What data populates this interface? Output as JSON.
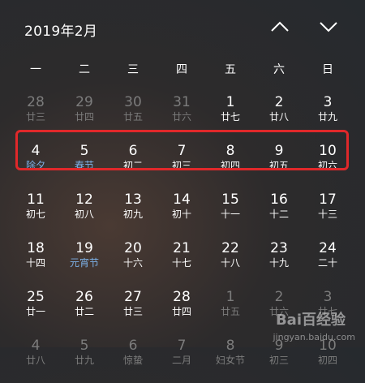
{
  "header": {
    "title": "2019年2月"
  },
  "weekdays": [
    "一",
    "二",
    "三",
    "四",
    "五",
    "六",
    "日"
  ],
  "weeks": [
    [
      {
        "d": "28",
        "l": "廿三",
        "muted": true
      },
      {
        "d": "29",
        "l": "廿四",
        "muted": true
      },
      {
        "d": "30",
        "l": "廿五",
        "muted": true
      },
      {
        "d": "31",
        "l": "廿六",
        "muted": true
      },
      {
        "d": "1",
        "l": "廿七"
      },
      {
        "d": "2",
        "l": "廿八"
      },
      {
        "d": "3",
        "l": "廿九"
      }
    ],
    [
      {
        "d": "4",
        "l": "除夕",
        "fest": true
      },
      {
        "d": "5",
        "l": "春节",
        "fest": true
      },
      {
        "d": "6",
        "l": "初二"
      },
      {
        "d": "7",
        "l": "初三"
      },
      {
        "d": "8",
        "l": "初四"
      },
      {
        "d": "9",
        "l": "初五"
      },
      {
        "d": "10",
        "l": "初六"
      }
    ],
    [
      {
        "d": "11",
        "l": "初七"
      },
      {
        "d": "12",
        "l": "初八"
      },
      {
        "d": "13",
        "l": "初九"
      },
      {
        "d": "14",
        "l": "初十"
      },
      {
        "d": "15",
        "l": "十一"
      },
      {
        "d": "16",
        "l": "十二"
      },
      {
        "d": "17",
        "l": "十三"
      }
    ],
    [
      {
        "d": "18",
        "l": "十四"
      },
      {
        "d": "19",
        "l": "元宵节",
        "fest": true
      },
      {
        "d": "20",
        "l": "十六"
      },
      {
        "d": "21",
        "l": "十七"
      },
      {
        "d": "22",
        "l": "十八"
      },
      {
        "d": "23",
        "l": "十九"
      },
      {
        "d": "24",
        "l": "二十"
      }
    ],
    [
      {
        "d": "25",
        "l": "廿一"
      },
      {
        "d": "26",
        "l": "廿二"
      },
      {
        "d": "27",
        "l": "廿三"
      },
      {
        "d": "28",
        "l": "廿四"
      },
      {
        "d": "1",
        "l": "廿五",
        "muted": true
      },
      {
        "d": "2",
        "l": "廿六",
        "muted": true
      },
      {
        "d": "3",
        "l": "廿七",
        "muted": true
      }
    ],
    [
      {
        "d": "4",
        "l": "廿八",
        "muted": true
      },
      {
        "d": "5",
        "l": "廿九",
        "muted": true
      },
      {
        "d": "6",
        "l": "惊蛰",
        "muted": true
      },
      {
        "d": "7",
        "l": "二月",
        "muted": true
      },
      {
        "d": "8",
        "l": "妇女节",
        "muted": true
      },
      {
        "d": "9",
        "l": "初三",
        "muted": true
      },
      {
        "d": "10",
        "l": "初四",
        "muted": true
      }
    ]
  ],
  "watermark": {
    "logo": "Bai百经验",
    "url": "jingyan.baidu.com"
  },
  "colors": {
    "festival": "#7cb0e6",
    "highlight": "#e0282a",
    "muted": "#7c7c7c"
  }
}
